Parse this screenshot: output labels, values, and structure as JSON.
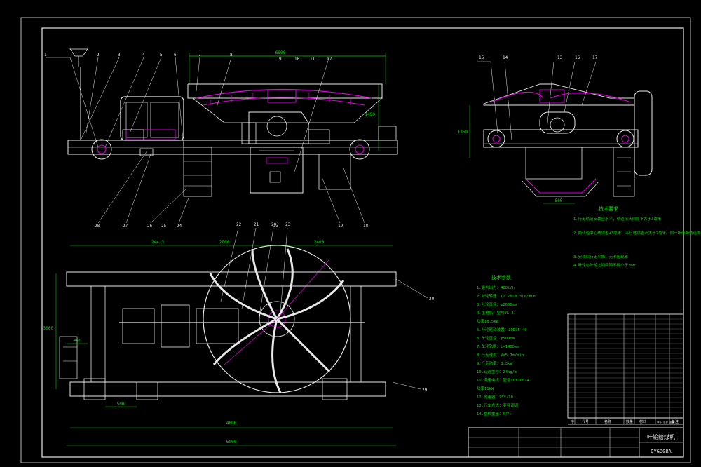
{
  "drawing": {
    "title_block": {
      "name": "叶轮给煤机",
      "code": "QYGD08A",
      "header_cells": [
        "序",
        "代号",
        "名称",
        "数量",
        "材料",
        "单件 总计 重量",
        "备注"
      ]
    },
    "dimensions": {
      "side_top_width": "6000",
      "side_right_height": "1450",
      "end_height": "1350",
      "end_bottom": "500",
      "plan_left_seg": "244.3",
      "plan_mid_seg": "2000",
      "plan_right_seg": "2400",
      "plan_height": "3000",
      "plan_small": "500",
      "plan_bottom_a": "4600",
      "plan_bottom_b": "6000",
      "plan_left_small": "460"
    },
    "callouts_side_top": [
      "1",
      "2",
      "3",
      "4",
      "5",
      "6",
      "7",
      "8",
      "9",
      "10",
      "11",
      "12"
    ],
    "callouts_side_bottom": [
      "28",
      "27",
      "26",
      "25",
      "24",
      "23",
      "19",
      "18"
    ],
    "callouts_end_top": [
      "15",
      "14",
      "13",
      "16",
      "17"
    ],
    "callouts_plan": [
      "22",
      "21",
      "20",
      "23",
      "20",
      "29"
    ],
    "tech_req": {
      "title": "技术要求",
      "items": [
        "1.行走轨道安装应水平，轨道接头间隙不大于3毫米",
        "2.两轨道中心线误差±3毫米，平行度误差不大于2毫米，同一断面两轨道面高低差不大于3毫米",
        "3.安装后行走平稳，无卡阻现象",
        "4.叶轮与叶轮之间间隙不得小于2mm"
      ]
    },
    "tech_params": {
      "title": "技术参数",
      "items": [
        "1.最大出力：400t/h",
        "2.叶轮转速：(2.76~8.3)r/min",
        "3.叶轮直径：φ2600mm",
        "4.主电机：型号YL-4",
        "   功率18.5kW",
        "5.叶轮驱动装置：ZQD75-40",
        "6.车轮直径：φ500mm",
        "7.车轮轨距：L=1400mm",
        "8.行走速度：V=5.7m/min",
        "9.行走功率：3.3kW",
        "10.轨道型号：24kg/m",
        "11.调速电机：型号YCT200-4",
        "    功率11kW",
        "12.减速器：ZSY-70",
        "13.行车方式：变频调速",
        "14.整机重量：约7t"
      ]
    }
  }
}
